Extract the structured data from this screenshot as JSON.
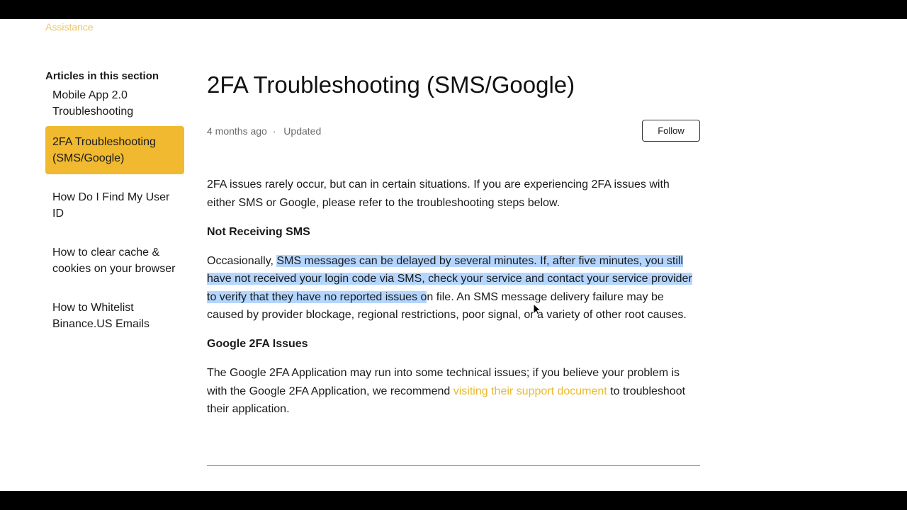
{
  "breadcrumb": {
    "label": "Assistance"
  },
  "sidebar": {
    "heading": "Articles in this section",
    "items": [
      {
        "label": "Mobile App 2.0 Troubleshooting",
        "active": false
      },
      {
        "label": "2FA Troubleshooting (SMS/Google)",
        "active": true
      },
      {
        "label": "How Do I Find My User ID",
        "active": false
      },
      {
        "label": "How to clear cache & cookies on your browser",
        "active": false
      },
      {
        "label": "How to Whitelist Binance.US Emails",
        "active": false
      }
    ]
  },
  "article": {
    "title": "2FA Troubleshooting (SMS/Google)",
    "meta": {
      "age": "4 months ago",
      "separator": "·",
      "status": "Updated"
    },
    "follow_label": "Follow",
    "intro": "2FA issues rarely occur, but can in certain situations. If you are experiencing 2FA issues with either SMS or Google, please refer to the troubleshooting steps below.",
    "section1": {
      "heading": "Not Receiving SMS",
      "text_before": "Occasionally, ",
      "text_selected": "SMS messages can be delayed by several minutes. If, after five minutes, you still have not received your login code via SMS, check your service and contact your service provider to verify that they have no reported issues o",
      "text_after": "n file. An SMS message delivery failure may be caused by provider blockage, regional restrictions, poor signal, or a variety of other root causes."
    },
    "section2": {
      "heading": "Google 2FA Issues",
      "text_before": "The Google 2FA Application may run into some technical issues; if you believe your problem is with the Google 2FA Application, we recommend ",
      "link_text": "visiting their support document",
      "text_after": " to troubleshoot their application."
    }
  },
  "colors": {
    "accent": "#f0b92f",
    "link": "#e8b931",
    "selection": "#b4d5fe"
  }
}
